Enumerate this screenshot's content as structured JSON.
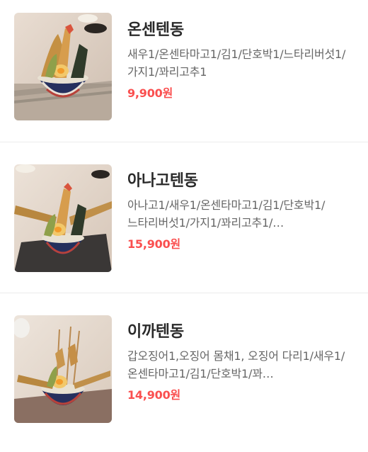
{
  "menu": {
    "items": [
      {
        "name": "온센텐동",
        "description": "새우1/온센타마고1/김1/단호박1/느타리버섯1/가지1/꽈리고추1",
        "price": "9,900원",
        "photo": "tempura-rice-bowl-photo"
      },
      {
        "name": "아나고텐동",
        "description": "아나고1/새우1/온센타마고1/김1/단호박1/느타리버섯1/가지1/꽈리고추1/…",
        "price": "15,900원",
        "photo": "tempura-rice-bowl-photo"
      },
      {
        "name": "이까텐동",
        "description": "갑오징어1,오징어 몸채1, 오징어 다리1/새우1/온센타마고1/김1/단호박1/꽈…",
        "price": "14,900원",
        "photo": "tempura-rice-bowl-photo"
      }
    ]
  },
  "colors": {
    "price": "#fa4f4f",
    "name": "#2a2a2a",
    "description": "#666666",
    "divider": "#ececec"
  }
}
